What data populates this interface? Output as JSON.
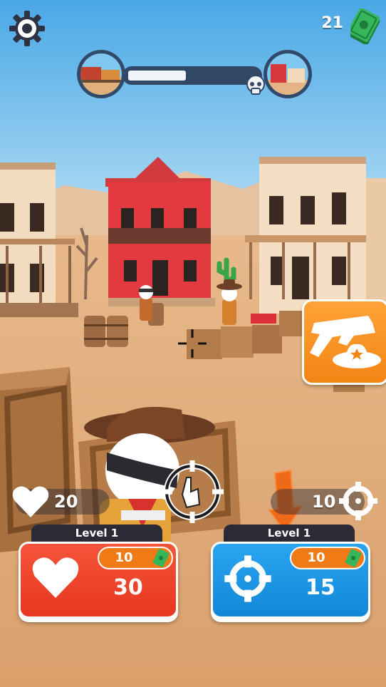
{
  "header": {
    "settings_icon": "gear-icon",
    "money_amount": "21",
    "money_icon": "cash-bill-icon"
  },
  "level_progress": {
    "fraction": 0.45,
    "start_thumbnail": "train-station-icon",
    "end_thumbnail": "western-town-icon",
    "end_marker": "skull-icon"
  },
  "stats": {
    "health_value": "20",
    "aim_value": "10"
  },
  "upgrades": {
    "health": {
      "level_label": "Level 1",
      "cost": "10",
      "value": "30",
      "icon": "heart-icon",
      "color": "#ee4426"
    },
    "aim": {
      "level_label": "Level 1",
      "cost": "10",
      "value": "15",
      "icon": "crosshair-icon",
      "color": "#1a93e2"
    }
  },
  "weapon_button": {
    "icon": "revolver-hat-icon",
    "color": "#f5901f"
  },
  "colors": {
    "sky": "#5eb4ea",
    "ground": "#e0a978",
    "accent_orange": "#f07a16"
  }
}
